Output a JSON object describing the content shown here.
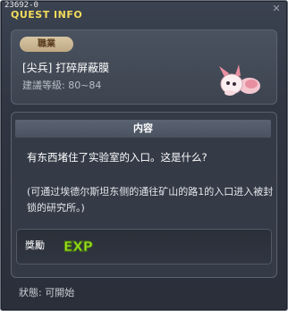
{
  "quest_id": "23692-0",
  "window": {
    "title": "QUEST INFO",
    "close_icon": "close-icon"
  },
  "header": {
    "job_badge": "職業",
    "quest_name": "[尖兵] 打碎屏蔽膜",
    "level_text": "建議等級: 80~84",
    "npc_icon": "pink-creature-icon"
  },
  "content": {
    "heading": "内容",
    "description": "有东西堵住了实验室的入口。这是什么?",
    "hint": "(可通过埃德尔斯坦东侧的通往矿山的路1的入口进入被封锁的研究所。)"
  },
  "reward": {
    "label": "獎勵",
    "exp_label": "EXP"
  },
  "status": "狀態: 可開始",
  "colors": {
    "title": "#f2dc5a",
    "exp_fill": "#9ee51e",
    "badge": "#cdb892"
  }
}
